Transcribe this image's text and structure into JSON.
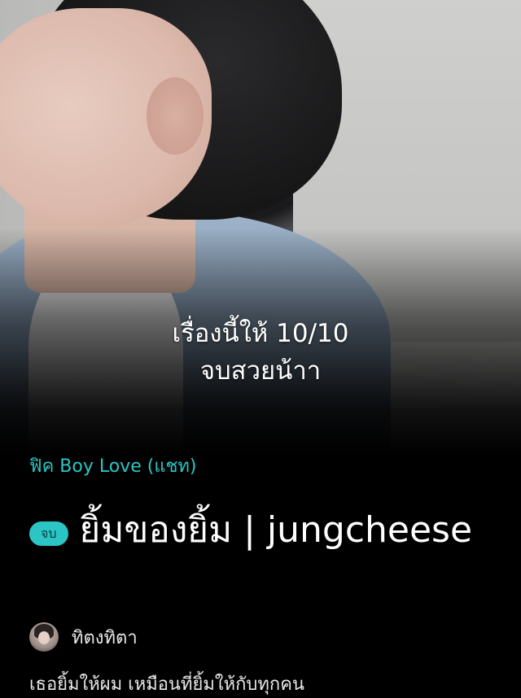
{
  "story": {
    "cover_overlay_line1": "เรื่องนี้ให้ 10/10",
    "cover_overlay_line2": "จบสวยน้าา",
    "category": "ฟิค Boy Love (แชท)",
    "status_badge": "จบ",
    "title": "ยิ้มของยิ้ม | jungcheese",
    "author": "ทิตงทิตา",
    "synopsis_preview": "เธอยิ้มให้ผม เหมือนที่ยิ้มให้กับทุกคน"
  },
  "colors": {
    "accent": "#2bc5c5",
    "background": "#000000",
    "text_primary": "#ffffff"
  }
}
